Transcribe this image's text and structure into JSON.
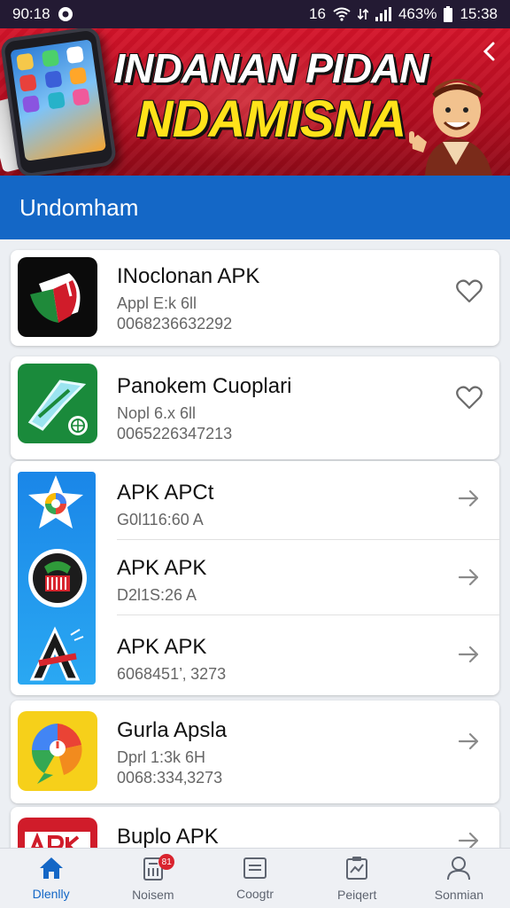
{
  "status_bar": {
    "time_left": "90:18",
    "time_right": "15:38",
    "battery": "463%",
    "network_label": "16"
  },
  "banner": {
    "title_line1": "INDANAN PIDAN",
    "title_line2": "NDAMISNA",
    "close_icon": "chevron-left-icon"
  },
  "section": {
    "title": "Undomham"
  },
  "apps": [
    {
      "name": "INoclonan APK",
      "sub": "Appl E:k 6ll",
      "code": "0068236632292",
      "action": "heart-icon"
    },
    {
      "name": "Panokem Cuoplari",
      "sub": "Nopl 6.x 6ll",
      "code": "0065226347213",
      "action": "heart-icon"
    },
    {
      "name": "APK APCt",
      "sub": "G0l116:60 A",
      "code": "",
      "action": "arrow-right-icon"
    },
    {
      "name": "APK APK",
      "sub": "D2l1S:26 A",
      "code": "",
      "action": "arrow-right-icon"
    },
    {
      "name": "APK APK",
      "sub": "6068451’‚ 3273",
      "code": "",
      "action": "arrow-right-icon"
    },
    {
      "name": "Gurla Apsla",
      "sub": "Dprl 1:3k 6H",
      "code": "0068:334‚3273",
      "action": "arrow-right-icon"
    },
    {
      "name": "Buplo APK",
      "sub": "",
      "code": "",
      "action": "arrow-right-icon"
    }
  ],
  "bottom_nav": [
    {
      "label": "Dlenlly",
      "icon": "home-icon",
      "active": true
    },
    {
      "label": "Noisem",
      "icon": "file-icon",
      "badge": "81"
    },
    {
      "label": "Coogtr",
      "icon": "document-icon"
    },
    {
      "label": "Peiqert",
      "icon": "clipboard-chart-icon"
    },
    {
      "label": "Sonmian",
      "icon": "user-icon"
    }
  ],
  "colors": {
    "status_bar_bg": "#231a33",
    "banner_red": "#d4142a",
    "banner_yellow": "#ffe21a",
    "section_blue": "#1467c6",
    "nav_active": "#1467c6"
  }
}
